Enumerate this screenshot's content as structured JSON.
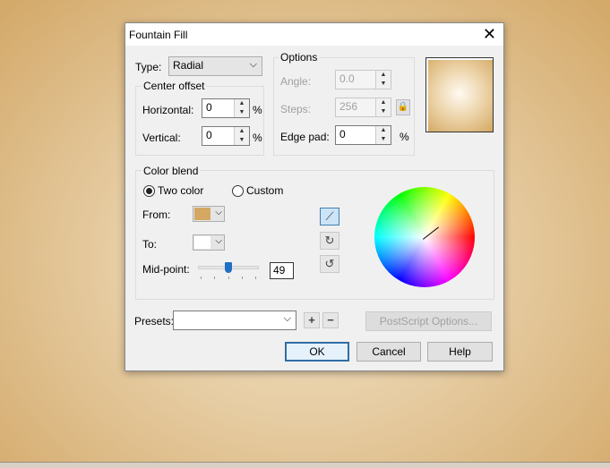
{
  "dialog": {
    "title": "Fountain Fill"
  },
  "type": {
    "label": "Type:",
    "value": "Radial"
  },
  "center_offset": {
    "title": "Center offset",
    "horizontal_label": "Horizontal:",
    "horizontal_value": "0",
    "vertical_label": "Vertical:",
    "vertical_value": "0",
    "unit": "%"
  },
  "options": {
    "title": "Options",
    "angle_label": "Angle:",
    "angle_value": "0.0",
    "steps_label": "Steps:",
    "steps_value": "256",
    "edge_pad_label": "Edge pad:",
    "edge_pad_value": "0",
    "unit": "%"
  },
  "color_blend": {
    "title": "Color blend",
    "two_color": "Two color",
    "custom": "Custom",
    "selected": "Two color",
    "from_label": "From:",
    "from_color": "#d4a862",
    "to_label": "To:",
    "to_color": "#ffffff",
    "midpoint_label": "Mid-point:",
    "midpoint_value": "49",
    "midpoint_percent": 49
  },
  "presets": {
    "label": "Presets:",
    "value": ""
  },
  "buttons": {
    "postscript": "PostScript Options...",
    "ok": "OK",
    "cancel": "Cancel",
    "help": "Help"
  }
}
